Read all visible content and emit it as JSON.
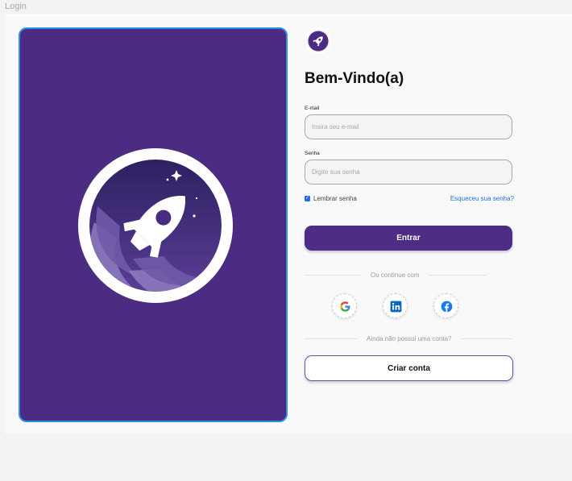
{
  "window": {
    "title": "Login"
  },
  "form": {
    "heading": "Bem-Vindo(a)",
    "email_label": "E-mail",
    "email_placeholder": "Insira seu e-mail",
    "email_value": "",
    "password_label": "Senha",
    "password_placeholder": "Digite sua senha",
    "password_value": "",
    "remember_label": "Lembrar senha",
    "remember_checked": true,
    "forgot_link": "Esqueceu sua senha?",
    "submit_label": "Entrar",
    "divider_social": "Ou continue com",
    "signup_prompt": "Ainda não possui uma conta?",
    "signup_label": "Criar conta"
  },
  "social": [
    {
      "name": "google",
      "icon": "google-icon"
    },
    {
      "name": "linkedin",
      "icon": "linkedin-icon"
    },
    {
      "name": "facebook",
      "icon": "facebook-icon"
    }
  ],
  "colors": {
    "brand_purple": "#4b2c82",
    "button_purple": "#4d2d85",
    "link_blue": "#1f6fe0",
    "hero_border": "#2f8fe6"
  },
  "icons": {
    "hero": "rocket-icon",
    "logo": "rocket-logo-icon"
  }
}
